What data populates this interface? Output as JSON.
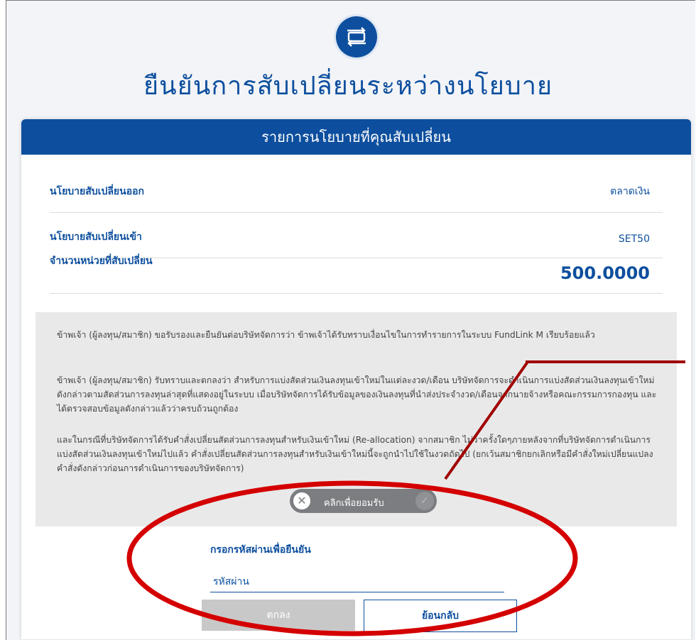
{
  "header": {
    "title": "ยืนยันการสับเปลี่ยนระหว่างนโยบาย"
  },
  "card": {
    "heading": "รายการนโยบายที่คุณสับเปลี่ยน",
    "rows": [
      {
        "label": "นโยบายสับเปลี่ยนออก",
        "value": "ตลาดเงิน"
      },
      {
        "label": "นโยบายสับเปลี่ยนเข้า",
        "value": "SET50"
      },
      {
        "label": "จำนวนหน่วยที่สับเปลี่ยน",
        "value": "500.0000"
      }
    ]
  },
  "terms": {
    "p1": "ข้าพเจ้า (ผู้ลงทุน/สมาชิก) ขอรับรองและยืนยันต่อบริษัทจัดการว่า ข้าพเจ้าได้รับทราบเงื่อนไขในการทำรายการในระบบ FundLink M เรียบร้อยแล้ว",
    "p2": "ข้าพเจ้า (ผู้ลงทุน/สมาชิก) รับทราบและตกลงว่า สำหรับการแบ่งสัดส่วนเงินลงทุนเข้าใหม่ในแต่ละงวด/เดือน บริษัทจัดการจะดำเนินการแบ่งสัดส่วนเงินลงทุนเข้าใหม่ดังกล่าวตามสัดส่วนการลงทุนล่าสุดที่แสดงอยู่ในระบบ เมื่อบริษัทจัดการได้รับข้อมูลของเงินลงทุนที่นำส่งประจำงวด/เดือนจากนายจ้างหรือคณะกรรมการกองทุน และได้ตรวจสอบข้อมูลดังกล่าวแล้วว่าครบถ้วนถูกต้อง",
    "p3": "และในกรณีที่บริษัทจัดการได้รับคำสั่งเปลี่ยนสัดส่วนการลงทุนสำหรับเงินเข้าใหม่ (Re-allocation) จากสมาชิก ไม่ว่าครั้งใดๆภายหลังจากที่บริษัทจัดการดำเนินการแบ่งสัดส่วนเงินลงทุนเข้าใหม่ไปแล้ว คำสั่งเปลี่ยนสัดส่วนการลงทุนสำหรับเงินเข้าใหม่นี้จะถูกนำไปใช้ในงวดถัดไป (ยกเว้นสมาชิกยกเลิกหรือมีคำสั่งใหม่เปลี่ยนแปลงคำสั่งดังกล่าวก่อนการดำเนินการของบริษัทจัดการ)",
    "toggle_label": "คลิกเพื่อยอมรับ"
  },
  "password": {
    "label": "กรอกรหัสผ่านเพื่อยืนยัน",
    "placeholder": "รหัสผ่าน"
  },
  "buttons": {
    "ok": "ตกลง",
    "back": "ย้อนกลับ"
  },
  "colors": {
    "brand": "#0d4f9e",
    "annotation": "#d40000"
  }
}
